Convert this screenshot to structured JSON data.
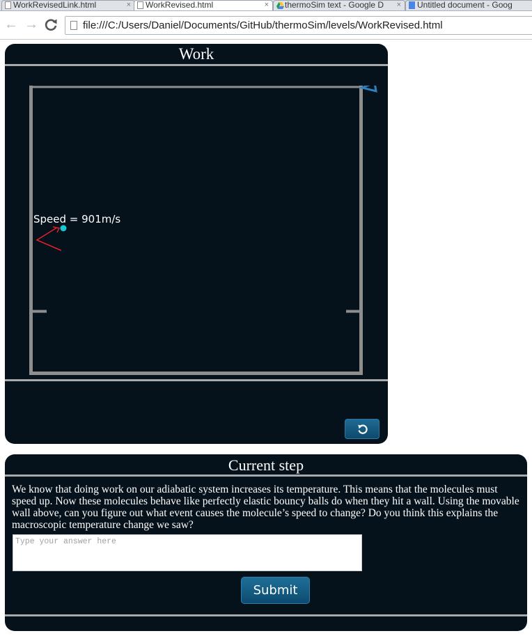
{
  "browser": {
    "tabs": [
      {
        "title": "WorkRevisedLink.html",
        "active": false,
        "favicon": "page-icon"
      },
      {
        "title": "WorkRevised.html",
        "active": true,
        "favicon": "page-icon"
      },
      {
        "title": "thermoSim text - Google D",
        "active": false,
        "favicon": "google-drive-icon"
      },
      {
        "title": "Untitled document - Goog",
        "active": false,
        "favicon": "google-docs-icon"
      }
    ],
    "tab_close_glyph": "×",
    "url": "file:///C:/Users/Daniel/Documents/GitHub/thermoSim/levels/WorkRevised.html",
    "icons": {
      "back": "back-arrow-icon",
      "forward": "forward-arrow-icon",
      "reload": "reload-icon"
    }
  },
  "work_panel": {
    "title": "Work",
    "simulation": {
      "speed_label": "Speed = 901m/s",
      "molecule_color": "#19c6d6",
      "velocity_arrow_color": "#e3202a",
      "wall_color": "#8e8e8e",
      "movable_wall_handle": "wall-handle-icon"
    },
    "reset_button_icon": "refresh-icon"
  },
  "step_panel": {
    "title": "Current step",
    "text": "We know that doing work on our adiabatic system increases its temperature. This means that the molecules must speed up. Now these molecules behave like perfectly elastic bouncy balls do when they hit a wall. Using the movable wall above, can you figure out what event causes the molecule’s speed to change? Do you think this explains the macroscopic temperature change we saw?",
    "answer_placeholder": "Type your answer here",
    "answer_value": "",
    "submit_label": "Submit"
  },
  "colors": {
    "panel_bg": "#05121c",
    "button_bg": "#0d4b70",
    "rule": "#a7a9ab"
  }
}
